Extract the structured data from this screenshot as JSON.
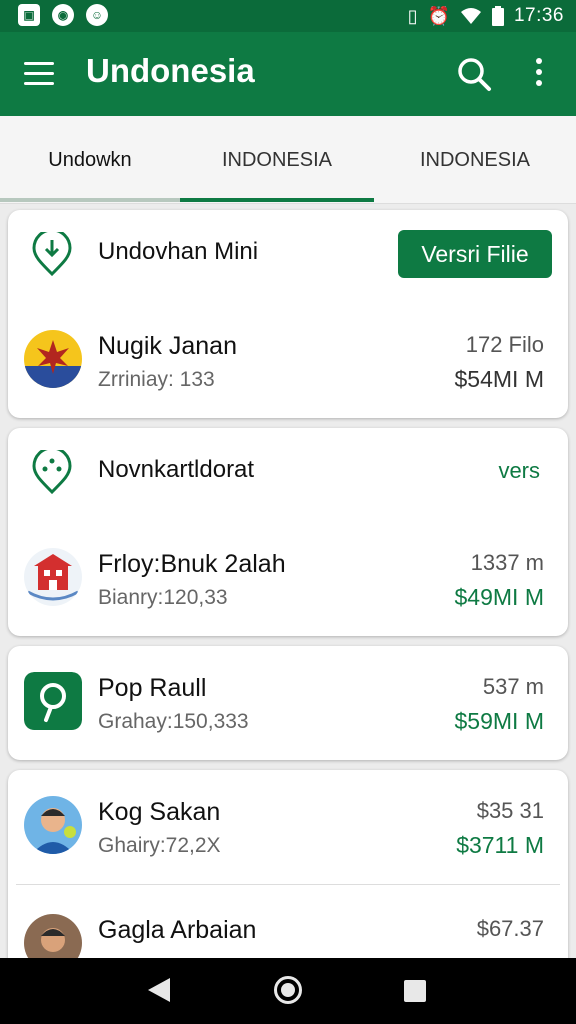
{
  "status_bar": {
    "time": "17:36",
    "icons": [
      "gallery-icon",
      "whatsapp-icon",
      "messenger-icon",
      "vibrate-icon",
      "alarm-icon",
      "wifi-icon",
      "battery-icon"
    ]
  },
  "app_bar": {
    "title": "Undonesia",
    "icons": [
      "menu-icon",
      "search-icon",
      "more-vert-icon"
    ]
  },
  "tabs": [
    {
      "label": "Undowkn",
      "active": false
    },
    {
      "label": "INDONESIA",
      "active": true
    },
    {
      "label": "INDONESIA",
      "active": false
    }
  ],
  "cards": [
    {
      "title": "Undovhan Mini",
      "action": "Versri Filie",
      "rows": [
        {
          "name": "Nugik Janan",
          "sub": "Zrriniay: 133",
          "value": "172 Filo",
          "price": "$54MI M"
        }
      ]
    },
    {
      "title": "Novnkartldorat",
      "action": "vers",
      "rows": [
        {
          "name": "Frloy:Bnuk 2alah",
          "sub": "Bianry:120,33",
          "value": "1337 m",
          "price": "$49MI M"
        }
      ]
    },
    {
      "rows": [
        {
          "name": "Pop Raull",
          "sub": "Grahay:150,333",
          "value": "537 m",
          "price": "$59MI M"
        }
      ]
    },
    {
      "rows": [
        {
          "name": "Kog Sakan",
          "sub": "Ghairy:72,2X",
          "value": "$35 31",
          "price": "$3711 M"
        },
        {
          "name": "Gagla Arbaian",
          "sub": "",
          "value": "$67.37",
          "price": ""
        }
      ]
    }
  ],
  "colors": {
    "primary": "#0e7a43",
    "status_bar": "#0b6b3a",
    "background": "#ececec"
  }
}
